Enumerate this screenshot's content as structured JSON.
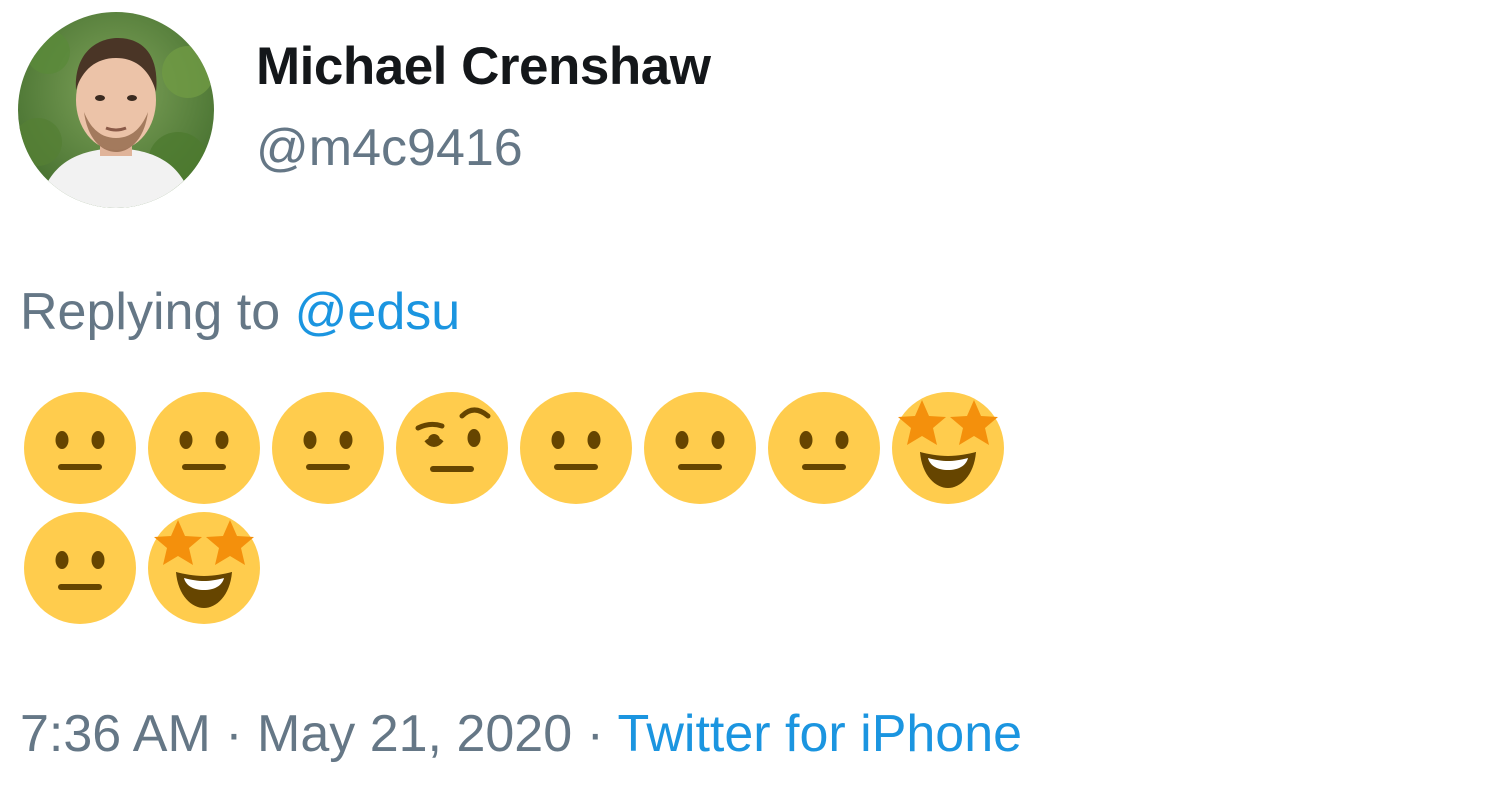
{
  "tweet": {
    "author": {
      "display_name": "Michael Crenshaw",
      "handle": "@m4c9416",
      "avatar": "profile-photo"
    },
    "reply": {
      "prefix": "Replying to",
      "mention": "@edsu"
    },
    "emoji_rows": [
      [
        "neutral-face-emoji",
        "neutral-face-emoji",
        "neutral-face-emoji",
        "face-with-raised-eyebrow-emoji",
        "neutral-face-emoji",
        "neutral-face-emoji",
        "neutral-face-emoji",
        "star-struck-emoji"
      ],
      [
        "neutral-face-emoji",
        "star-struck-emoji"
      ]
    ],
    "meta": {
      "time": "7:36 AM",
      "separator": "·",
      "date": "May 21, 2020",
      "source": "Twitter for iPhone"
    }
  },
  "colors": {
    "name_text": "#14171a",
    "secondary_text": "#657786",
    "link_blue": "#1b95e0",
    "emoji_yellow": "#ffcc4d",
    "emoji_features": "#664500",
    "emoji_star": "#f4900c"
  }
}
